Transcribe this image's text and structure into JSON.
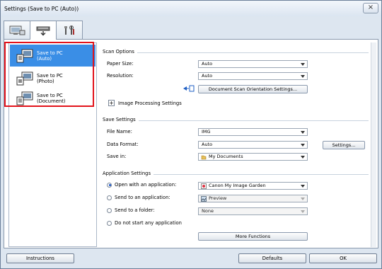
{
  "window": {
    "title": "Settings (Save to PC (Auto))",
    "close_label": "×"
  },
  "tabs": [
    {
      "icon": "scan-from-computer-icon"
    },
    {
      "icon": "scanner-panel-icon"
    },
    {
      "icon": "general-settings-icon"
    }
  ],
  "sidebar": {
    "items": [
      {
        "line1": "Save to PC",
        "line2": "(Auto)",
        "icon": "save-to-pc-icon"
      },
      {
        "line1": "Save to PC",
        "line2": "(Photo)",
        "icon": "save-to-pc-icon"
      },
      {
        "line1": "Save to PC",
        "line2": "(Document)",
        "icon": "save-to-pc-icon"
      }
    ]
  },
  "scan_options": {
    "title": "Scan Options",
    "paper_size_label": "Paper Size:",
    "paper_size_value": "Auto",
    "resolution_label": "Resolution:",
    "resolution_value": "Auto",
    "orientation_button": "Document Scan Orientation Settings...",
    "image_processing_label": "Image Processing Settings"
  },
  "save_settings": {
    "title": "Save Settings",
    "file_name_label": "File Name:",
    "file_name_value": "IMG",
    "data_format_label": "Data Format:",
    "data_format_value": "Auto",
    "settings_button": "Settings...",
    "save_in_label": "Save in:",
    "save_in_value": "My Documents"
  },
  "application_settings": {
    "title": "Application Settings",
    "open_with_label": "Open with an application:",
    "open_with_value": "Canon My Image Garden",
    "send_to_app_label": "Send to an application:",
    "send_to_app_value": "Preview",
    "send_to_folder_label": "Send to a folder:",
    "send_to_folder_value": "None",
    "do_not_start_label": "Do not start any application",
    "more_functions_button": "More Functions"
  },
  "footer": {
    "instructions": "Instructions",
    "defaults": "Defaults",
    "ok": "OK"
  }
}
